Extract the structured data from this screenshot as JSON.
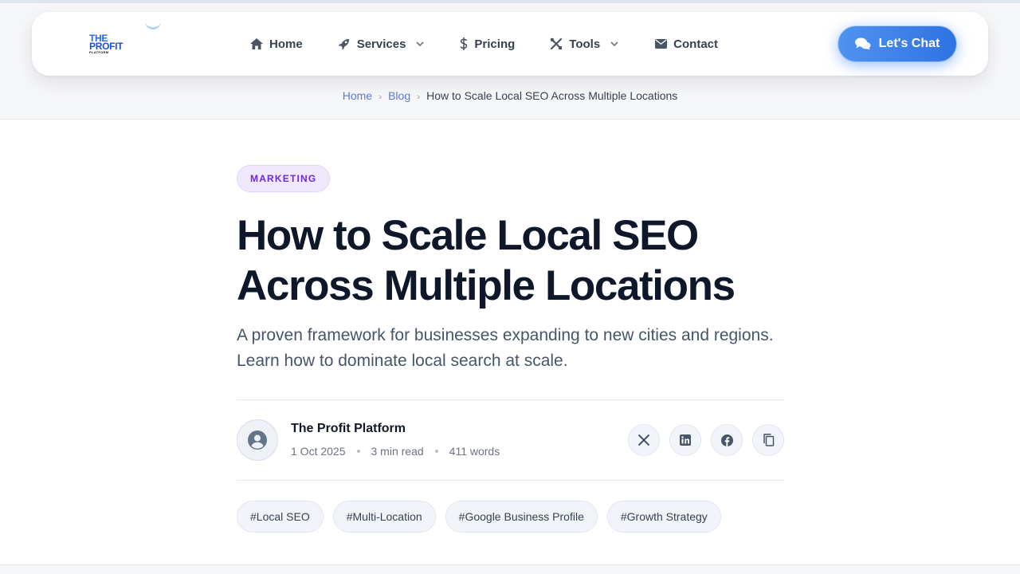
{
  "brand": {
    "logo_line1": "THE",
    "logo_line2": "PROFIT",
    "logo_line3": "PLATFORM",
    "accent": "#2f72e3"
  },
  "nav": {
    "items": [
      {
        "label": "Home",
        "icon": "home-icon",
        "dropdown": false
      },
      {
        "label": "Services",
        "icon": "rocket-icon",
        "dropdown": true
      },
      {
        "label": "Pricing",
        "icon": "dollar-icon",
        "dropdown": false
      },
      {
        "label": "Tools",
        "icon": "tools-icon",
        "dropdown": true
      },
      {
        "label": "Contact",
        "icon": "envelope-icon",
        "dropdown": false
      }
    ],
    "cta_label": "Let's Chat",
    "cta_icon": "chat-bubbles-icon"
  },
  "breadcrumb": {
    "home": "Home",
    "blog": "Blog",
    "current": "How to Scale Local SEO Across Multiple Locations"
  },
  "article": {
    "category": "MARKETING",
    "category_color": "#6d28d9",
    "title": "How to Scale Local SEO Across Multiple Locations",
    "subtitle": "A proven framework for businesses expanding to new cities and regions. Learn how to dominate local search at scale.",
    "author": "The Profit Platform",
    "date": "1 Oct 2025",
    "read_time": "3 min read",
    "word_count": "411 words",
    "share": [
      "x-icon",
      "linkedin-icon",
      "facebook-icon",
      "copy-icon"
    ],
    "tags": [
      "#Local SEO",
      "#Multi-Location",
      "#Google Business Profile",
      "#Growth Strategy"
    ]
  }
}
